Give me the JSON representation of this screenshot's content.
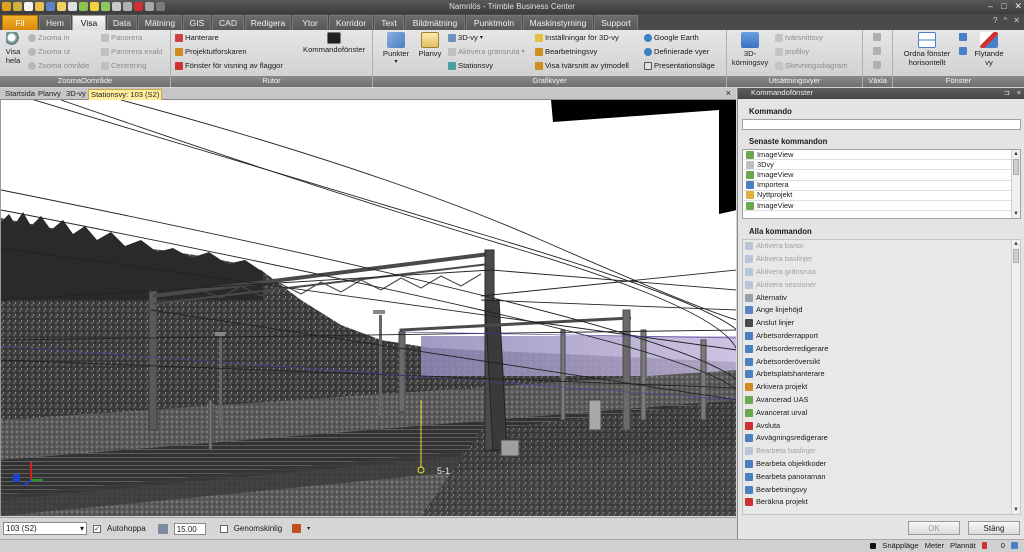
{
  "app": {
    "title": "Namnlös - Trimble Business Center",
    "help_icon": "question-mark",
    "window_controls": [
      "minimize",
      "maximize",
      "close"
    ]
  },
  "tabs": [
    {
      "label": "Fil",
      "style": "file"
    },
    {
      "label": "Hem"
    },
    {
      "label": "Visa",
      "active": true
    },
    {
      "label": "Data"
    },
    {
      "label": "Mätning"
    },
    {
      "label": "GIS"
    },
    {
      "label": "CAD"
    },
    {
      "label": "Redigera"
    },
    {
      "label": "Ytor"
    },
    {
      "label": "Korridor"
    },
    {
      "label": "Text"
    },
    {
      "label": "Bildmätning"
    },
    {
      "label": "Punktmoln"
    },
    {
      "label": "Maskinstyrning"
    },
    {
      "label": "Support"
    }
  ],
  "ribbon": {
    "zoom": {
      "label": "ZoomaOområde",
      "visa_hela": [
        "Visa",
        "hela"
      ],
      "zoom_in": "Zooma in",
      "zoom_out": "Zooma ut",
      "zoom_area": "Zooma område",
      "pan": "Panorera",
      "pan_exact": "Panorera exakt",
      "center": "Centrering"
    },
    "rutor": {
      "label": "Rutor",
      "manage": "Hanterare",
      "explorer": "Projektutforskaren",
      "flag_window": "Fönster för visning av flaggor",
      "command_window": "Kommandofönster"
    },
    "grafik": {
      "label": "Grafikvyer",
      "points": "Punkter",
      "planview": "Planvy",
      "view3d": "3D-vy",
      "activate_boundary": "Aktivera gränsruta",
      "stationview": "Stationsvy",
      "settings3d": "Inställningar för 3D-vy",
      "editview": "Bearbetningsvy",
      "cross_section": "Visa tvärsnitt av ytmodell",
      "google_earth": "Google Earth",
      "defined_views": "Definierade vyer",
      "presentation": "Presentationsläge"
    },
    "utsattning": {
      "label": "Utsättningsvyer",
      "view3d": [
        "3D-",
        "körningsvy"
      ],
      "cross": "tvärsnittsvy",
      "profile": "profilvy",
      "tilt": "Skevningsdiagram"
    },
    "vaxla": {
      "label": "Växla"
    },
    "fonster": {
      "label": "Fönster",
      "arrange": [
        "Ordna fönster",
        "horisontellt"
      ],
      "floating": [
        "Flytande",
        "vy"
      ]
    }
  },
  "doc_tabs": [
    "Startsida",
    "Planvy",
    "3D-vy",
    "Stationsvy: 103 (S2)"
  ],
  "viewport": {
    "station_label": "5-1",
    "axis_colors": {
      "x": "#d42020",
      "y": "#1f9a1f",
      "z": "#2040d0"
    }
  },
  "bottom": {
    "station_select": "103 (S2)",
    "autohop_label": "Autohoppa",
    "autohop_checked": true,
    "distance_value": "15.00",
    "transparent_label": "Genomskinlig",
    "transparent_checked": false
  },
  "status": {
    "snap": "Snäppläge",
    "unit": "Meter",
    "plane": "Plannät",
    "count": "0"
  },
  "panel": {
    "title": "Kommandofönster",
    "command_label": "Kommando",
    "recent_label": "Senaste kommandon",
    "recent": [
      {
        "label": "ImageView",
        "icon": "#6aa84f"
      },
      {
        "label": "3Dvy",
        "icon": "#c0c0c0"
      },
      {
        "label": "ImageView",
        "icon": "#6aa84f"
      },
      {
        "label": "Importera",
        "icon": "#4a7fc1"
      },
      {
        "label": "Nyttprojekt",
        "icon": "#e0b040"
      },
      {
        "label": "ImageView",
        "icon": "#6aa84f"
      }
    ],
    "all_label": "Alla kommandon",
    "all": [
      {
        "label": "Aktivera banor",
        "disabled": true,
        "icon": "#b8c6d8"
      },
      {
        "label": "Aktivera baslinjer",
        "disabled": true,
        "icon": "#b8c6d8"
      },
      {
        "label": "Aktivera gränsruta",
        "disabled": true,
        "icon": "#b8c6d8"
      },
      {
        "label": "Aktivera sessioner",
        "disabled": true,
        "icon": "#b8c6d8"
      },
      {
        "label": "Alternativ",
        "disabled": false,
        "icon": "#9aa0a8"
      },
      {
        "label": "Ange linjehöjd",
        "disabled": false,
        "icon": "#5a84c8"
      },
      {
        "label": "Anslut linjer",
        "disabled": false,
        "icon": "#4a4a4a"
      },
      {
        "label": "Arbetsorderrapport",
        "disabled": false,
        "icon": "#4a7fc1"
      },
      {
        "label": "Arbetsorderredigerare",
        "disabled": false,
        "icon": "#4a7fc1"
      },
      {
        "label": "Arbetsorderöversikt",
        "disabled": false,
        "icon": "#4a7fc1"
      },
      {
        "label": "Arbetsplatshanterare",
        "disabled": false,
        "icon": "#4a7fc1"
      },
      {
        "label": "Arkivera projekt",
        "disabled": false,
        "icon": "#d08a20"
      },
      {
        "label": "Avancerad UAS",
        "disabled": false,
        "icon": "#6aa84f"
      },
      {
        "label": "Avancerat urval",
        "disabled": false,
        "icon": "#6aa84f"
      },
      {
        "label": "Avsluta",
        "disabled": false,
        "icon": "#d03030"
      },
      {
        "label": "Avvägningsredigerare",
        "disabled": false,
        "icon": "#4a7fc1"
      },
      {
        "label": "Bearbeta baslinjer",
        "disabled": true,
        "icon": "#b8c6d8"
      },
      {
        "label": "Bearbeta objektkoder",
        "disabled": false,
        "icon": "#4a7fc1"
      },
      {
        "label": "Bearbeta panoraman",
        "disabled": false,
        "icon": "#4a7fc1"
      },
      {
        "label": "Bearbetningsvy",
        "disabled": false,
        "icon": "#4a7fc1"
      },
      {
        "label": "Beräkna projekt",
        "disabled": false,
        "icon": "#d03030"
      }
    ],
    "ok": "OK",
    "close": "Stäng"
  }
}
